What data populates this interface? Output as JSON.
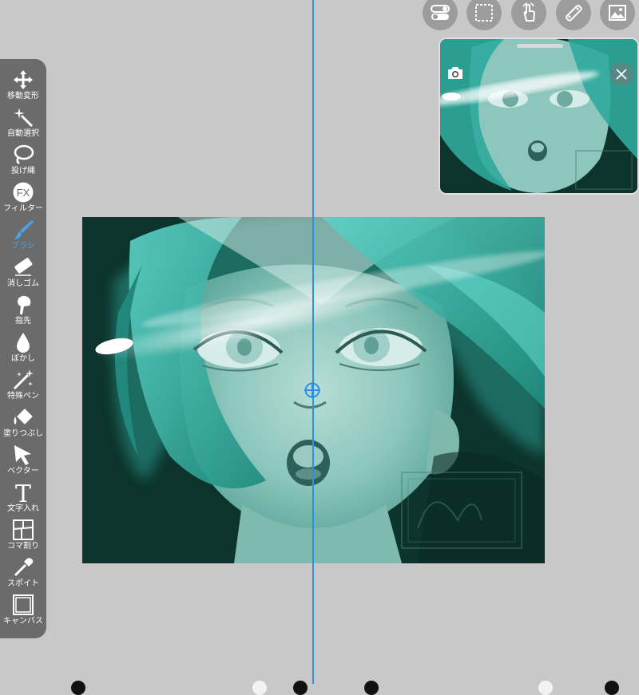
{
  "toolbar": {
    "tools": [
      {
        "label": "移動変形",
        "icon": "move-transform-icon"
      },
      {
        "label": "自動選択",
        "icon": "magic-wand-icon"
      },
      {
        "label": "投げ縄",
        "icon": "lasso-icon"
      },
      {
        "label": "フィルター",
        "icon": "fx-icon",
        "icon_text": "FX"
      },
      {
        "label": "ブラシ",
        "icon": "brush-icon",
        "active": true
      },
      {
        "label": "消しゴム",
        "icon": "eraser-icon"
      },
      {
        "label": "指先",
        "icon": "finger-smudge-icon"
      },
      {
        "label": "ぼかし",
        "icon": "blur-drop-icon"
      },
      {
        "label": "特殊ペン",
        "icon": "special-pen-icon"
      },
      {
        "label": "塗りつぶし",
        "icon": "fill-bucket-icon"
      },
      {
        "label": "ベクター",
        "icon": "vector-cursor-icon"
      },
      {
        "label": "文字入れ",
        "icon": "text-icon",
        "icon_text": "T"
      },
      {
        "label": "コマ割り",
        "icon": "panel-split-icon"
      },
      {
        "label": "スポイト",
        "icon": "eyedropper-icon"
      },
      {
        "label": "キャンバス",
        "icon": "canvas-icon"
      }
    ]
  },
  "top_bar": {
    "buttons": [
      "toggle-settings-icon",
      "selection-marquee-icon",
      "gesture-hand-icon",
      "ruler-icon",
      "reference-image-icon"
    ]
  },
  "navigator": {
    "camera_icon": "camera-icon",
    "close_icon": "close-icon"
  },
  "colors": {
    "background": "#c8c8c8",
    "toolbar": "#6b6b6b",
    "active_tool": "#4aa3f0",
    "guide_line": "#2f8fe6",
    "artwork_teal": "#2fa89c",
    "artwork_dark": "#0c342c"
  }
}
